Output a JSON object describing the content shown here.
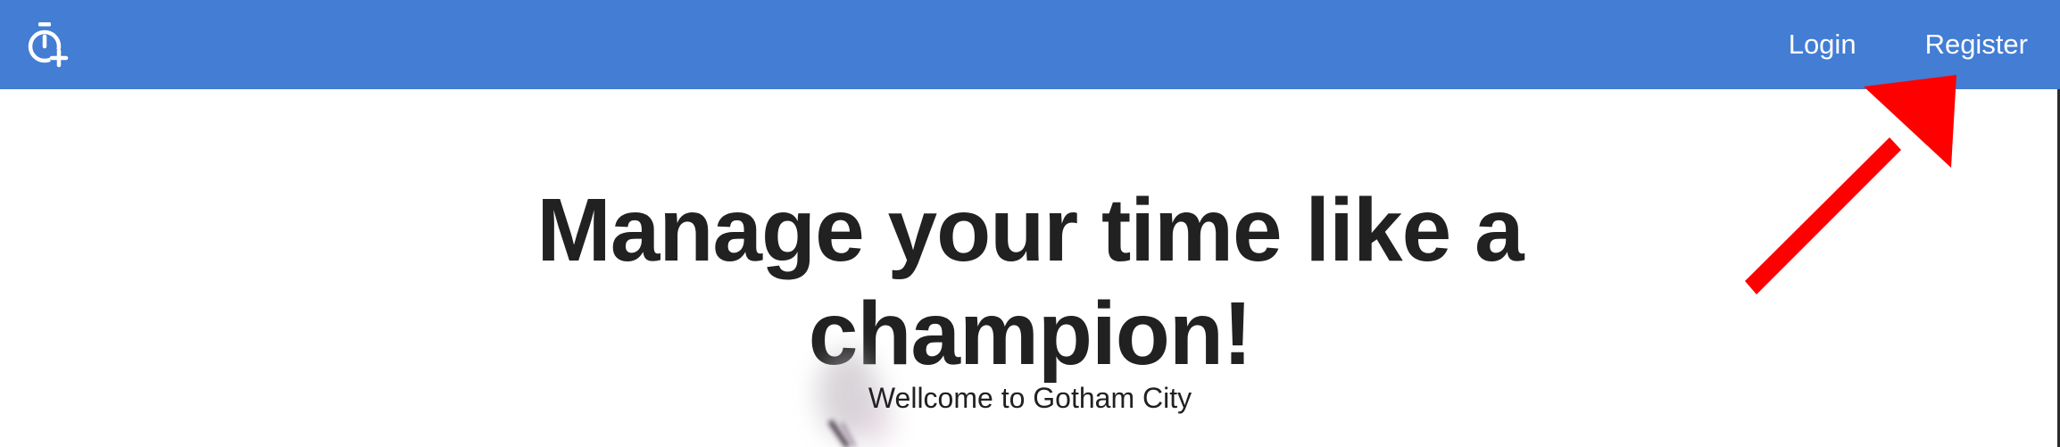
{
  "navbar": {
    "brand_icon": "stopwatch-plus-icon",
    "links": [
      {
        "label": "Login"
      },
      {
        "label": "Register"
      }
    ],
    "background_color": "#437dd4",
    "text_color": "#ffffff"
  },
  "hero": {
    "title_line1": "Manage your time like a",
    "title_line2": "champion!",
    "subtitle": "Wellcome to Gotham City",
    "text_color": "#212121"
  },
  "annotation": {
    "arrow_icon": "red-arrow-icon",
    "color": "#ff0000"
  }
}
